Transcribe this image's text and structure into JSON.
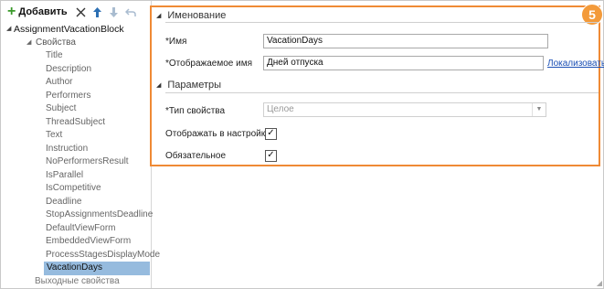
{
  "toolbar": {
    "add_label": "Добавить",
    "icons": [
      "delete-icon",
      "move-up-icon",
      "move-down-icon",
      "undo-icon"
    ]
  },
  "tree": {
    "root": "AssignmentVacationBlock",
    "group": "Свойства",
    "items": [
      "Title",
      "Description",
      "Author",
      "Performers",
      "Subject",
      "ThreadSubject",
      "Text",
      "Instruction",
      "NoPerformersResult",
      "IsParallel",
      "IsCompetitive",
      "Deadline",
      "StopAssignmentsDeadline",
      "DefaultViewForm",
      "EmbeddedViewForm",
      "ProcessStagesDisplayMode"
    ],
    "selected": "VacationDays",
    "next_group": "Выходные свойства"
  },
  "naming": {
    "title": "Именование",
    "name_label": "*Имя",
    "name_value": "VacationDays",
    "display_label": "*Отображаемое имя",
    "display_value": "Дней отпуска",
    "localize_link": "Локализовать"
  },
  "params": {
    "title": "Параметры",
    "type_label": "*Тип свойства",
    "type_value": "Целое",
    "show_label": "Отображать в настройках",
    "show_checked": true,
    "required_label": "Обязательное",
    "required_checked": true
  },
  "badge": "5",
  "colors": {
    "highlight": "#ef8a35",
    "selection": "#96bbde",
    "link": "#1a4fb5"
  }
}
